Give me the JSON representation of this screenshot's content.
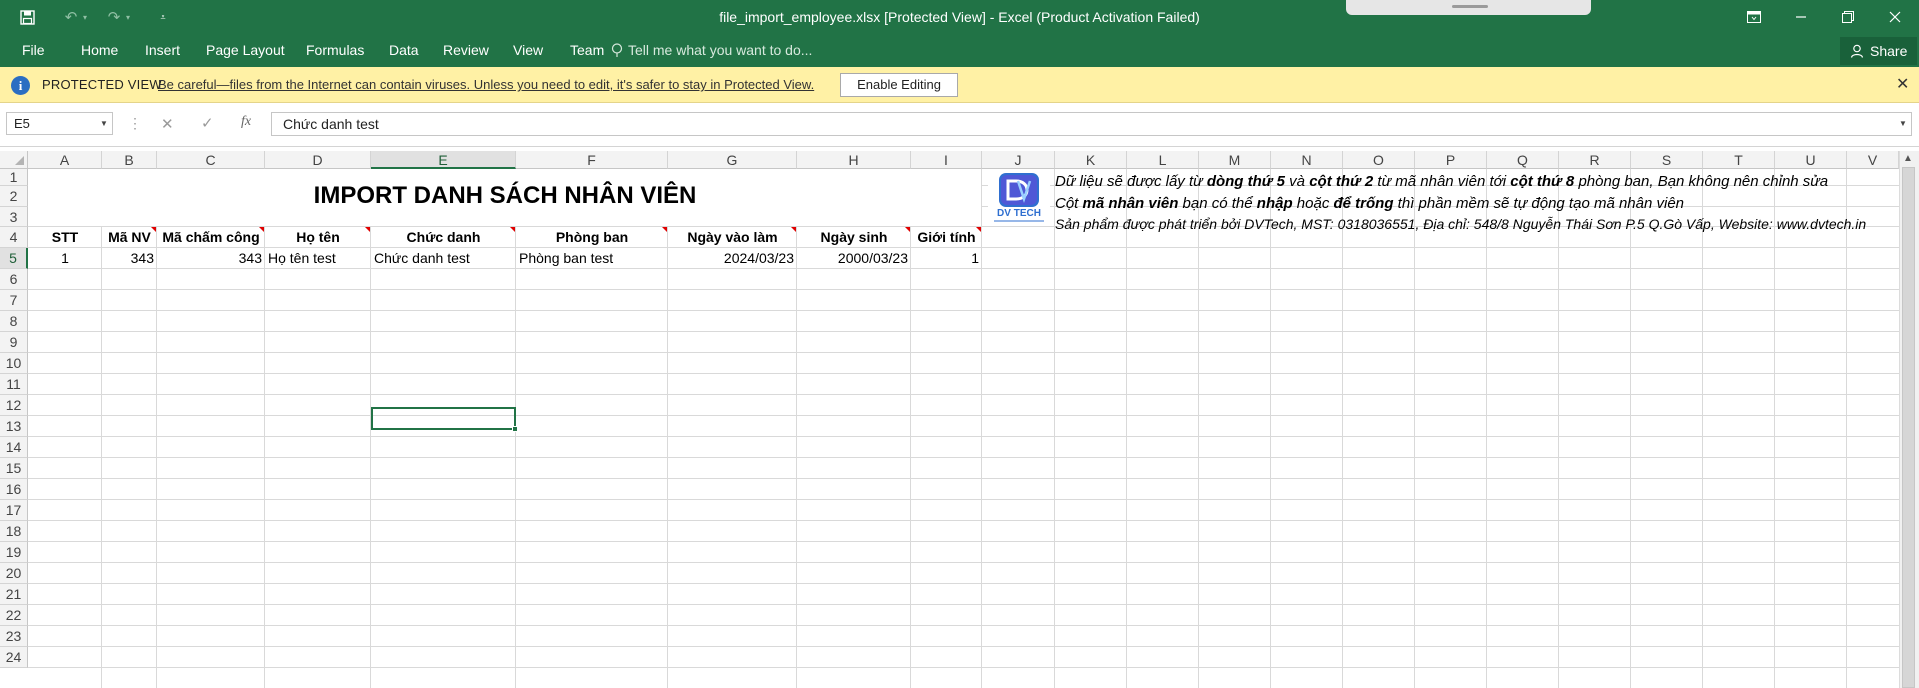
{
  "titlebar": {
    "title": "file_import_employee.xlsx  [Protected View] - Excel (Product Activation Failed)",
    "save_icon": "floppy-save-icon",
    "undo_icon": "undo-icon",
    "redo_icon": "redo-icon",
    "customize_icon": "customize-quick-access-icon",
    "window_buttons": [
      "ribbon-display-options-icon",
      "minimize-icon",
      "restore-icon",
      "close-icon"
    ]
  },
  "ribbon": {
    "tabs": [
      "File",
      "Home",
      "Insert",
      "Page Layout",
      "Formulas",
      "Data",
      "Review",
      "View",
      "Team"
    ],
    "tell_me": "Tell me what you want to do...",
    "share": "Share"
  },
  "protected_view": {
    "title": "PROTECTED VIEW",
    "message": "Be careful—files from the Internet can contain viruses. Unless you need to edit, it's safer to stay in Protected View.",
    "button": "Enable Editing"
  },
  "formula_bar": {
    "name_box": "E5",
    "fx": "fx",
    "content": "Chức danh test"
  },
  "sheet": {
    "columns": [
      "A",
      "B",
      "C",
      "D",
      "E",
      "F",
      "G",
      "H",
      "I",
      "J",
      "K",
      "L",
      "M",
      "N",
      "O",
      "P",
      "Q",
      "R",
      "S",
      "T",
      "U",
      "V"
    ],
    "selected_column": "E",
    "rows": [
      "1",
      "2",
      "3",
      "4",
      "5",
      "6",
      "7",
      "8",
      "9",
      "10",
      "11",
      "12",
      "13",
      "14",
      "15",
      "16",
      "17",
      "18",
      "19",
      "20",
      "21",
      "22",
      "23",
      "24"
    ],
    "selected_row": "5",
    "title": "IMPORT DANH SÁCH NHÂN VIÊN",
    "headers": [
      "STT",
      "Mã NV",
      "Mã chấm công",
      "Họ tên",
      "Chức danh",
      "Phòng ban",
      "Ngày vào làm",
      "Ngày sinh",
      "Giới tính"
    ],
    "row5": [
      "1",
      "343",
      "343",
      "Họ tên test",
      "Chức danh test",
      "Phòng ban test",
      "2024/03/23",
      "2000/03/23",
      "1"
    ],
    "logo_text": "DV TECH",
    "notes": {
      "line1_parts": [
        "Dữ liệu sẽ được lấy từ ",
        "dòng thứ 5",
        " và ",
        "cột thứ 2",
        " từ mã nhân viên tới ",
        "cột thứ 8",
        " phòng ban, Bạn không nên chỉnh sửa"
      ],
      "line2_parts": [
        "Cột ",
        "mã nhân viên",
        " bạn có thể ",
        "nhập",
        " hoặc ",
        "để trống",
        " thì phần mềm sẽ tự động tạo mã nhân viên"
      ],
      "line3": "Sản phẩm được phát triển bởi DVTech, MST: 0318036551, Địa chỉ: 548/8 Nguyễn Thái Sơn P.5 Q.Gò Vấp, Website: www.dvtech.in"
    }
  },
  "colors": {
    "excel_green": "#217346",
    "protected_yellow": "#fff1a5",
    "comment_red": "#e00000",
    "logo_blue": "#2f6fd0"
  }
}
